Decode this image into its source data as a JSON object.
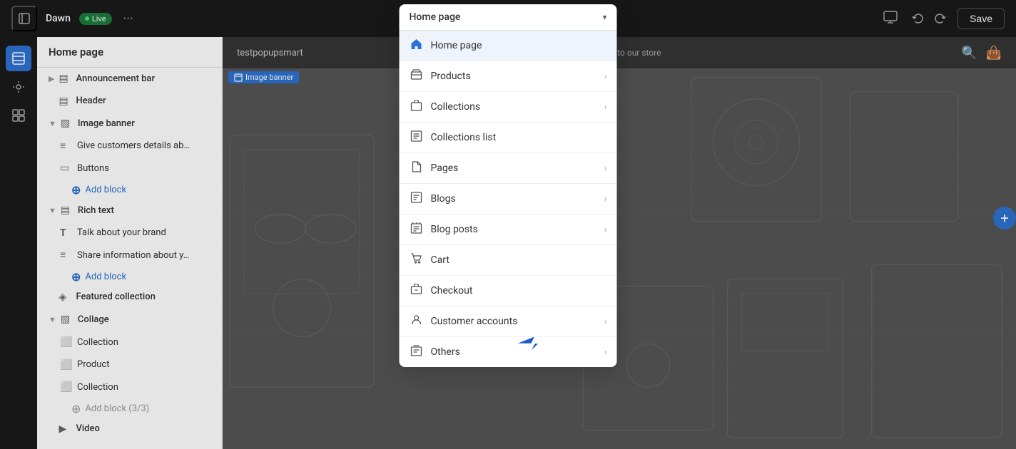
{
  "topbar": {
    "store_name": "Dawn",
    "live_label": "Live",
    "more_icon": "···",
    "page_selector_value": "Home page",
    "save_label": "Save"
  },
  "sidebar": {
    "title": "Home page",
    "items": [
      {
        "id": "announcement-bar",
        "label": "Announcement bar",
        "icon": "▤",
        "indent": 0,
        "has_chevron": true
      },
      {
        "id": "header",
        "label": "Header",
        "icon": "▤",
        "indent": 0,
        "has_chevron": false
      },
      {
        "id": "image-banner",
        "label": "Image banner",
        "icon": "▨",
        "indent": 0,
        "has_chevron": true
      },
      {
        "id": "give-customers",
        "label": "Give customers details ab…",
        "icon": "≡",
        "indent": 1
      },
      {
        "id": "buttons",
        "label": "Buttons",
        "icon": "▭",
        "indent": 1
      },
      {
        "id": "add-block-image",
        "label": "Add block",
        "indent": 1,
        "is_add": true
      },
      {
        "id": "rich-text",
        "label": "Rich text",
        "icon": "▤",
        "indent": 0,
        "has_chevron": true
      },
      {
        "id": "talk-about",
        "label": "Talk about your brand",
        "icon": "T",
        "indent": 1
      },
      {
        "id": "share-info",
        "label": "Share information about y…",
        "icon": "≡",
        "indent": 1
      },
      {
        "id": "add-block-rich",
        "label": "Add block",
        "indent": 1,
        "is_add": true
      },
      {
        "id": "featured-collection",
        "label": "Featured collection",
        "icon": "◈",
        "indent": 0,
        "has_chevron": false
      },
      {
        "id": "collage",
        "label": "Collage",
        "icon": "▨",
        "indent": 0,
        "has_chevron": true
      },
      {
        "id": "collage-collection",
        "label": "Collection",
        "icon": "⬜",
        "indent": 1
      },
      {
        "id": "collage-product",
        "label": "Product",
        "icon": "⬜",
        "indent": 1
      },
      {
        "id": "collage-collection2",
        "label": "Collection",
        "icon": "⬜",
        "indent": 1
      },
      {
        "id": "add-block-collage",
        "label": "Add block (3/3)",
        "indent": 1,
        "is_add": true,
        "disabled": true
      },
      {
        "id": "video",
        "label": "Video",
        "icon": "▶",
        "indent": 0,
        "has_chevron": false
      }
    ]
  },
  "dropdown": {
    "trigger_label": "Home page",
    "items": [
      {
        "id": "home-page",
        "label": "Home page",
        "icon": "🏠",
        "active": true,
        "has_arrow": false
      },
      {
        "id": "products",
        "label": "Products",
        "icon": "🏷",
        "active": false,
        "has_arrow": true
      },
      {
        "id": "collections",
        "label": "Collections",
        "icon": "📁",
        "active": false,
        "has_arrow": true
      },
      {
        "id": "collections-list",
        "label": "Collections list",
        "icon": "📋",
        "active": false,
        "has_arrow": false
      },
      {
        "id": "pages",
        "label": "Pages",
        "icon": "📄",
        "active": false,
        "has_arrow": true
      },
      {
        "id": "blogs",
        "label": "Blogs",
        "icon": "📰",
        "active": false,
        "has_arrow": true
      },
      {
        "id": "blog-posts",
        "label": "Blog posts",
        "icon": "📝",
        "active": false,
        "has_arrow": true
      },
      {
        "id": "cart",
        "label": "Cart",
        "icon": "🛒",
        "active": false,
        "has_arrow": false
      },
      {
        "id": "checkout",
        "label": "Checkout",
        "icon": "🛻",
        "active": false,
        "has_arrow": false
      },
      {
        "id": "customer-accounts",
        "label": "Customer accounts",
        "icon": "👤",
        "active": false,
        "has_arrow": true
      },
      {
        "id": "others",
        "label": "Others",
        "icon": "🗄",
        "active": false,
        "has_arrow": true
      }
    ]
  },
  "preview": {
    "store_url": "testpopupsmart",
    "welcome_text": "me to our store"
  },
  "icons": {
    "undo": "↩",
    "redo": "↪",
    "desktop": "🖥",
    "customize": "⚙",
    "search": "🔍",
    "bag": "👜",
    "arrow_down": "▾",
    "arrow_right": "›",
    "plus": "+"
  }
}
